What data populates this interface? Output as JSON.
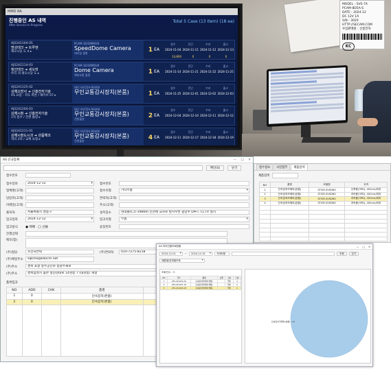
{
  "colors": {
    "tv_background": "#0d1b4a",
    "tv_row_background": "#10224f",
    "tv_accent": "#7fc4ff",
    "qty_color": "#ffd966",
    "highlight_row": "#f9f0b7",
    "pie_color": "#a8cdea"
  },
  "tv": {
    "window_label": "MMD RA",
    "title": "진행중인 AS 내역",
    "subtitle": "After Service In Progress",
    "total": "Total 5 Case (13 Item) (18 ea)",
    "rows": [
      {
        "id": "AJS241104-05",
        "route": "명성테크 ➜ 트루엔",
        "note": "해오시닷 도 4 ▸",
        "code": "PCAM-1D/36M6V8",
        "product": "SpeedDome Camera",
        "product_sub": "대리점 결항",
        "qty": "1",
        "unit": "EA",
        "dates": [
          {
            "head": "접수",
            "value": "2024-11-04"
          },
          {
            "head": "진단",
            "value": "2024-11-11"
          },
          {
            "head": "수리",
            "value": "2024-11-12"
          },
          {
            "head": "출고",
            "value": "2024-11-13"
          }
        ],
        "extra": [
          "14,800",
          "0",
          "0",
          "0"
        ]
      },
      {
        "id": "AJS241114-03",
        "route": "청인테크 ➜ 세오력",
        "note": "수리 처 해오시닷 도 ▸",
        "code": "PCAM-1D/36M6V8",
        "product": "Dome Camera",
        "product_sub": "해외부품 불량",
        "qty": "1",
        "unit": "EA",
        "dates": [
          {
            "head": "접수",
            "value": "2024-11-14"
          },
          {
            "head": "진단",
            "value": "2024-11-21"
          },
          {
            "head": "수리",
            "value": "2024-11-22"
          },
          {
            "head": "출고",
            "value": "2024-11-25"
          }
        ],
        "extra": []
      },
      {
        "id": "AJS241125-02",
        "route": "김해소방서 ➜ 신흥전자기술",
        "note": "AS 요청 : 지도 파손 / 패키브 07 ▸",
        "code": "SEC-SVCD4-9SV60",
        "product": "무인교통감시장치(본품)",
        "product_sub": "",
        "qty": "1",
        "unit": "EA",
        "dates": [
          {
            "head": "접수",
            "value": "2024-11-25"
          },
          {
            "head": "진단",
            "value": "2024-12-01"
          },
          {
            "head": "수리",
            "value": "2024-12-02"
          },
          {
            "head": "출고",
            "value": "2024-12-03"
          }
        ],
        "extra": []
      },
      {
        "id": "AJS241204-03",
        "route": "김해시청 ➜ 신흥전자기술",
        "note": "1차 접수 / 전원 불량 ▸",
        "code": "SEC-SVCD4-9SV60",
        "product": "무인교통감시장치(본품)",
        "product_sub": "전원불량",
        "qty": "2",
        "unit": "EA",
        "dates": [
          {
            "head": "접수",
            "value": "2024-12-04"
          },
          {
            "head": "진단",
            "value": "2024-12-10"
          },
          {
            "head": "수리",
            "value": "2024-12-11"
          },
          {
            "head": "출고",
            "value": "2024-12-12"
          }
        ],
        "extra": []
      },
      {
        "id": "AJS241211-01",
        "route": "김해시청도시과 ➜ 완품해조",
        "note": "처리 2차 / 교체 요청 ▸",
        "code": "SEC-SVCD4-9SV60",
        "product": "무인교통감시장치(본품)",
        "product_sub": "전원불량",
        "qty": "4",
        "unit": "EA",
        "dates": [
          {
            "head": "접수",
            "value": "2024-12-11"
          },
          {
            "head": "진단",
            "value": "2024-12-17"
          },
          {
            "head": "수리",
            "value": "2024-12-18"
          },
          {
            "head": "출고",
            "value": "2024-12-19"
          }
        ],
        "extra": []
      }
    ]
  },
  "label_sticker": {
    "lines": [
      "MODEL : SVS-7A",
      "PCAM-8D5A-S",
      "DATE : 2024.12",
      "DC 12V 1A",
      "S/N : 3020",
      "HTTP://SECAM.COM",
      "수입판매원 : 신흥전자"
    ],
    "cert_mark": "KC"
  },
  "main_window": {
    "title": "AS 신규등록",
    "controls": [
      "—",
      "□",
      "✕"
    ],
    "buttons": {
      "save": "확인(S)",
      "close": "닫기"
    },
    "form": {
      "receipt_no_label": "접수번호",
      "receipt_date_label": "접수일자",
      "receipt_date": "2024-12-12",
      "receipt_no2_label": "접수번호",
      "receipt_no2": "",
      "customer_label": "업체명(고객)",
      "customer": "",
      "category_label": "접수유형",
      "category": "기타부품",
      "phone_label": "담당자(고객)",
      "phone": "",
      "tel_label": "연락처(고객)",
      "tel": "",
      "mobile_label": "이메일(고객)",
      "mobile": "",
      "addr_label": "주소(고객)",
      "addr": "",
      "company_label": "출처처",
      "company": "서울특별시 성동구",
      "site_label": "설치장소",
      "site": "현대출(C크-19869) 인천에 교차로 방지우번 광장수 D루드 CCTV 설치",
      "manager_label": "입고일자",
      "manager": "2024-12-12",
      "in_type_label": "입고유형",
      "in_type": "부품",
      "in_method_label": "입고방식",
      "in_method_options": [
        "● 택배",
        "◯ 선불"
      ],
      "invoice_label": "송장번호",
      "invoice": "",
      "status_label": "진행상태",
      "status": "",
      "memo_label": "메모(참)",
      "memo": ""
    },
    "contact": {
      "a_label": "(주)접담",
      "a_value": "소전자연락",
      "b_label": "(주)연락처",
      "b_value": "010-7275-8218",
      "c_label": "(주)메일주소",
      "c_value": "sqkmo@kdocm.net",
      "d_label": "(주)주소",
      "d_value": "경북 포항 동주공단로 용남주새로",
      "e_label": "(주)주소",
      "e_value": "경북삼성시 높은 앞길현대로 14현동 7 (대현동) 계열"
    },
    "items_title": "품목입고",
    "items_headers": [
      "NO",
      "ADD",
      "CHK",
      "품명",
      "모델",
      "시리얼",
      "수량"
    ],
    "items": [
      {
        "no": "1",
        "add": "0",
        "chk": "",
        "name": "단속장치(본품)",
        "model": "STVM-SVSD60",
        "serial": "",
        "qty": "1"
      },
      {
        "no": "2",
        "add": "0",
        "chk": "",
        "name": "단속장치(본품)",
        "model": "STVM-SVSD60",
        "serial": "",
        "qty": "1"
      }
    ]
  },
  "right_window": {
    "tabs": [
      "접수정보",
      "사진첨부",
      "제품검색"
    ],
    "code_label": "제품검색",
    "headers": [
      "NO",
      "품명",
      "모델명",
      "규격"
    ],
    "rows": [
      {
        "no": "1",
        "name": "단속장치카메라(본품)",
        "model": "STVM-SVSD60",
        "spec": "신축용(3PD), 400cm/위치"
      },
      {
        "no": "2",
        "name": "단속장치카메라(본품)",
        "model": "STVM-SVSD60",
        "spec": "과속용(3PD), 400cm/위치"
      },
      {
        "no": "3",
        "name": "단속장치카메라(본품)",
        "model": "STVM-SVSD60",
        "spec": "과속용(3PD), 400cm/위치"
      },
      {
        "no": "4",
        "name": "단속장치카메라(본품)",
        "model": "STVM-SVSD60",
        "spec": "과속용(3PD), 400cm/위치"
      }
    ],
    "highlight_index": 2
  },
  "popup": {
    "title": "AS 처리건별조회현황",
    "controls": [
      "—",
      "□",
      "✕"
    ],
    "date_from": "2024-12-01",
    "date_to": "2024-12-31",
    "filter_field": "거래처명",
    "buttons": {
      "search": "조회",
      "close": "닫기"
    },
    "group_field": "제품별/업체별조회",
    "count_label": "조회건수 : 3",
    "headers": [
      "NO",
      "접수",
      "품명",
      "모델",
      "구분",
      "수량"
    ],
    "rows": [
      {
        "no": "1",
        "date": "AFS-241204-01",
        "name": "단속장치카메라(본품)",
        "model": "",
        "type": "일반",
        "qty": "4"
      },
      {
        "no": "2",
        "date": "AFS-241211-01",
        "name": "단속장치카메라(본품)",
        "model": "",
        "type": "일반",
        "qty": "2"
      },
      {
        "no": "3",
        "date": "AFS-241204-03",
        "name": "단속장치카메라(본품)",
        "model": "",
        "type": "일반",
        "qty": "4"
      }
    ],
    "highlight_index": 2,
    "chart_data": {
      "type": "pie",
      "labels": [
        "단속장치카메라(본품) : 10"
      ],
      "values": [
        10
      ],
      "title": ""
    }
  }
}
